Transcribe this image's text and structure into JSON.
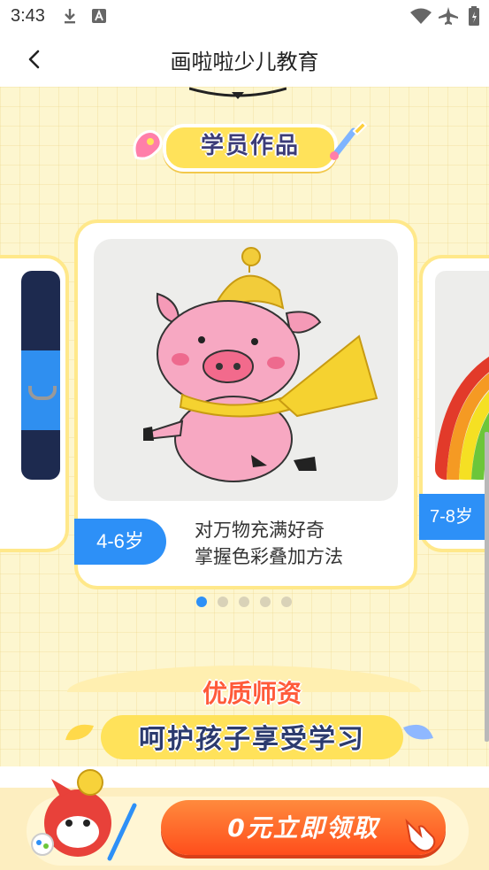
{
  "status_bar": {
    "time": "3:43"
  },
  "header": {
    "title": "画啦啦少儿教育"
  },
  "section_works": {
    "banner": "学员作品",
    "cards": [
      {
        "age": "4-6岁",
        "desc_line1": "对万物充满好奇",
        "desc_line2": "掌握色彩叠加方法"
      },
      {
        "age": "7-8岁"
      }
    ],
    "pagination": {
      "count": 5,
      "active": 1
    }
  },
  "section_teachers": {
    "title": "优质师资",
    "subtitle": "呵护孩子享受学习"
  },
  "cta": {
    "label": "0元立即领取"
  },
  "colors": {
    "accent_blue": "#2d90f7",
    "cta_orange": "#ff5a24",
    "bg_yellow": "#fdf6cf"
  }
}
